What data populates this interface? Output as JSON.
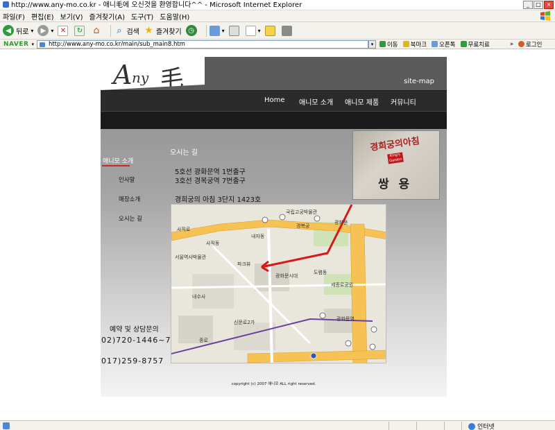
{
  "window": {
    "title": "http://www.any-mo.co.kr - 애니毛에 오신것을 환영합니다^^ - Microsoft Internet Explorer",
    "min_glyph": "_",
    "max_glyph": "□",
    "close_glyph": "×"
  },
  "menu": [
    "파일(F)",
    "편집(E)",
    "보기(V)",
    "즐겨찾기(A)",
    "도구(T)",
    "도움말(H)"
  ],
  "toolbar": {
    "back_label": "뒤로",
    "back_glyph": "◀",
    "forward_glyph": "▶",
    "stop_glyph": "✕",
    "refresh_glyph": "↻",
    "home_glyph": "⌂",
    "search_glyph": "⌕",
    "search_label": "검색",
    "favorites_glyph": "★",
    "favorites_label": "즐겨찾기",
    "history_glyph": "◷",
    "dropdown_glyph": "▾"
  },
  "addressbar": {
    "naver_label": "NAVER",
    "url": "http://www.any-mo.co.kr/main/sub_main8.htm",
    "dropdown_glyph": "▾",
    "go_label": "이동",
    "bookmark_label": "북마크",
    "ohnclick_label": "오픈톡",
    "free_label": "무료치료",
    "more_glyph": "»",
    "login_label": "로그인"
  },
  "site": {
    "logo_any_a": "A",
    "logo_any_ny": "ny",
    "logo_mo": "毛",
    "sitemap_label": "site-map",
    "nav": [
      "Home",
      "애니모 소개",
      "애니모 제품",
      "커뮤니티"
    ],
    "sidebar": {
      "title": "애니모 소개",
      "items": [
        "인사말",
        "매장소개",
        "오시는 길"
      ]
    },
    "section_title": "오시는 길",
    "directions": [
      "5호선 광화문역 1번출구",
      "3호선 경복궁역 7번출구",
      "경희궁의 아침 3단지 1423호"
    ],
    "photo": {
      "sign_text": "경희궁의아침",
      "badge_text": "King's Garden",
      "sign2_text": "쌍 용"
    },
    "map_labels": {
      "gyeongbokgung": "경복궁",
      "gwanghwamun": "광화문",
      "sajikro": "사직로",
      "naejadong": "내자동",
      "sajikdong": "사직동",
      "sinmunro": "신문로2가",
      "jongno": "종로",
      "sejong": "세종로공원",
      "doyeomdong": "도렴동",
      "naesusa": "내수사",
      "gwanghwamunstation": "광화문역",
      "parkview": "파크뷰",
      "seoul_museum": "국립고궁박물관",
      "hanguk_gwanghwa": "광화문시대",
      "seoul_city": "서울역사박물관"
    },
    "contact": {
      "title": "예약 및 상담문의",
      "phones": [
        "02)720-1446~7",
        "017)259-8757"
      ]
    },
    "copyright": "copyright (c) 2007 애니모 ALL right reserved."
  },
  "status": {
    "zone_label": "인터넷"
  }
}
